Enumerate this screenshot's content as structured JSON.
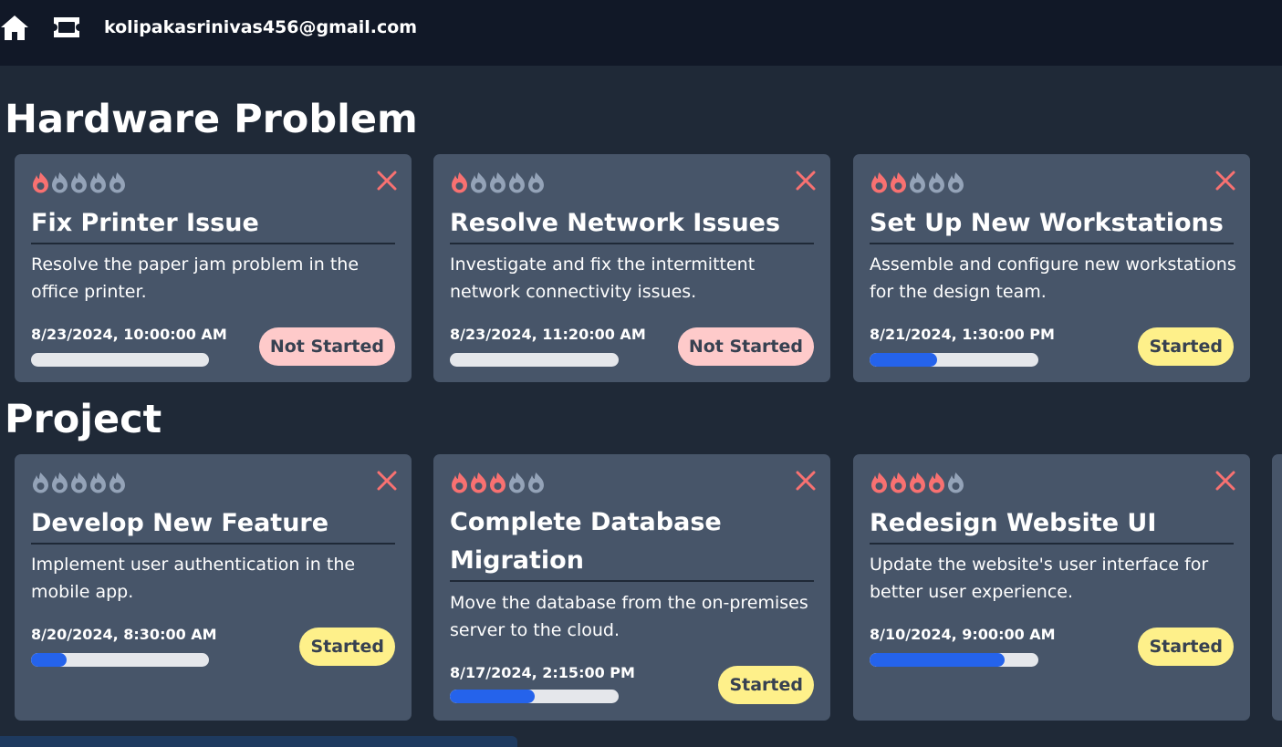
{
  "header": {
    "user_email": "kolipakasrinivas456@gmail.com"
  },
  "sections": [
    {
      "title": "Hardware Problem",
      "cards": [
        {
          "title": "Fix Printer Issue",
          "description": "Resolve the paper jam problem in the office printer.",
          "date": "8/23/2024, 10:00:00 AM",
          "status": "Not Started",
          "priority": 1,
          "progress": 0
        },
        {
          "title": "Resolve Network Issues",
          "description": "Investigate and fix the intermittent network connectivity issues.",
          "date": "8/23/2024, 11:20:00 AM",
          "status": "Not Started",
          "priority": 1,
          "progress": 0
        },
        {
          "title": "Set Up New Workstations",
          "description": "Assemble and configure new workstations for the design team.",
          "date": "8/21/2024, 1:30:00 PM",
          "status": "Started",
          "priority": 2,
          "progress": 0.4
        }
      ]
    },
    {
      "title": "Project",
      "cards": [
        {
          "title": "Develop New Feature",
          "description": "Implement user authentication in the mobile app.",
          "date": "8/20/2024, 8:30:00 AM",
          "status": "Started",
          "priority": 0,
          "progress": 0.2
        },
        {
          "title": "Complete Database Migration",
          "description": "Move the database from the on-premises server to the cloud.",
          "date": "8/17/2024, 2:15:00 PM",
          "status": "Started",
          "priority": 3,
          "progress": 0.5
        },
        {
          "title": "Redesign Website UI",
          "description": "Update the website's user interface for better user experience.",
          "date": "8/10/2024, 9:00:00 AM",
          "status": "Started",
          "priority": 4,
          "progress": 0.8
        }
      ]
    }
  ],
  "colors": {
    "flame_active": "#f87171",
    "flame_inactive": "#94a3b8",
    "close": "#f87171",
    "progress_fill": "#2563eb"
  }
}
